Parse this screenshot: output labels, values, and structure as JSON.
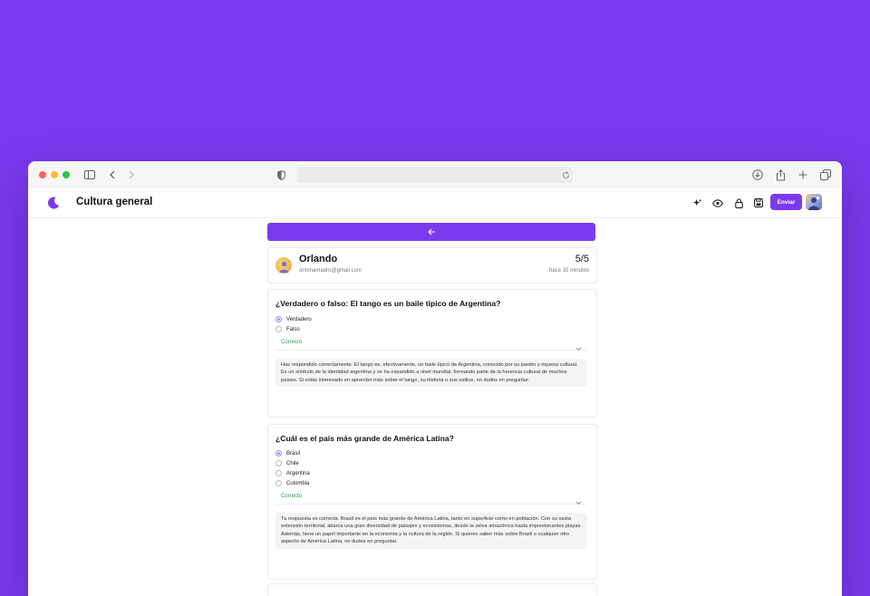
{
  "app": {
    "title": "Cultura general",
    "send_label": "Enviar"
  },
  "colors": {
    "accent": "#7c3aed",
    "correct": "#16a34a"
  },
  "browser": {
    "icons": [
      "sidebar-icon",
      "back-icon",
      "forward-icon",
      "shield-icon",
      "reload-icon",
      "download-icon",
      "share-icon",
      "plus-icon",
      "tabs-icon"
    ]
  },
  "header_icons": [
    "sparkles-icon",
    "eye-icon",
    "lock-icon",
    "save-icon"
  ],
  "user": {
    "name": "Orlando",
    "email": "orminamadro@gmail.com",
    "score": "5/5",
    "time": "hace 32 minutos"
  },
  "questions": [
    {
      "title": "¿Verdadero o falso: El tango es un baile típico de Argentina?",
      "options": [
        "Verdadero",
        "Falso"
      ],
      "selected": 0,
      "result": "Correcto",
      "explanation": "Has respondido correctamente. El tango es, efectivamente, un baile típico de Argentina, conocido por su pasión y riqueza cultural. Es un símbolo de la identidad argentina y se ha expandido a nivel mundial, formando parte de la herencia cultural de muchos países. Si estás interesado en aprender más sobre el tango, su historia o sus estilos, no dudes en preguntar."
    },
    {
      "title": "¿Cuál es el país más grande de América Latina?",
      "options": [
        "Brasil",
        "Chile",
        "Argentina",
        "Colombia"
      ],
      "selected": 0,
      "result": "Correcto",
      "explanation": "Tu respuesta es correcta. Brasil es el país más grande de América Latina, tanto en superficie como en población. Con su vasta extensión territorial, abarca una gran diversidad de paisajes y ecosistemas, desde la selva amazónica hasta impresionantes playas. Además, tiene un papel importante en la economía y la cultura de la región. Si quieres saber más sobre Brasil o cualquier otro aspecto de América Latina, no dudes en preguntar."
    }
  ]
}
